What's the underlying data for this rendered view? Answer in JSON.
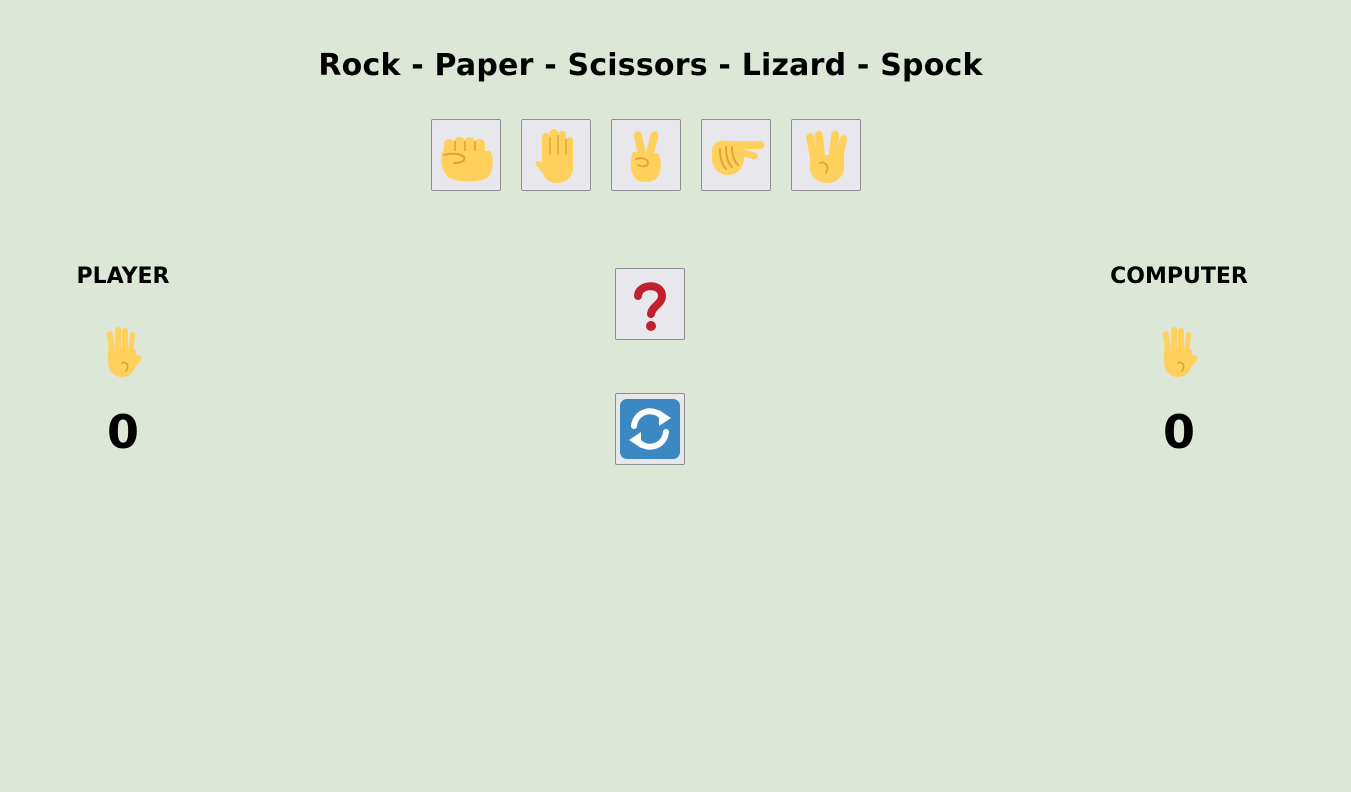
{
  "title": "Rock - Paper - Scissors - Lizard - Spock",
  "choices": [
    {
      "name": "rock",
      "icon": "raised-fist-icon"
    },
    {
      "name": "paper",
      "icon": "raised-hand-icon"
    },
    {
      "name": "scissors",
      "icon": "victory-hand-icon"
    },
    {
      "name": "lizard",
      "icon": "pinched-hand-icon"
    },
    {
      "name": "spock",
      "icon": "vulcan-salute-icon"
    }
  ],
  "player": {
    "label": "PLAYER",
    "hand_icon": "hand-splayed-icon",
    "score": "0"
  },
  "computer": {
    "label": "COMPUTER",
    "hand_icon": "hand-splayed-icon",
    "score": "0"
  },
  "result": {
    "icon": "question-mark-icon"
  },
  "reset": {
    "icon": "refresh-icon"
  },
  "colors": {
    "background": "#dce7d8",
    "tile": "#e8e8ec",
    "skin": "#ffd05c",
    "skin_shade": "#e2a23b",
    "question": "#c1202f",
    "refresh": "#3b88c3"
  }
}
